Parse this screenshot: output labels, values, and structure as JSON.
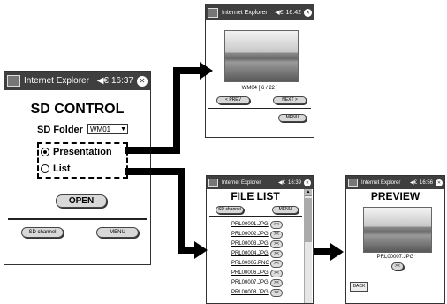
{
  "main_screen": {
    "titlebar": {
      "app": "Internet Explorer",
      "speaker": "◀€",
      "time": "16:37",
      "close": "✕"
    },
    "heading": "SD CONTROL",
    "folder_label": "SD Folder",
    "folder_value": "WM01",
    "options": [
      {
        "label": "Presentation",
        "selected": true
      },
      {
        "label": "List",
        "selected": false
      }
    ],
    "open_button": "OPEN",
    "sd_channel_button": "SD channel",
    "menu_button": "MENU"
  },
  "viewer_screen": {
    "titlebar": {
      "app": "Internet Explorer",
      "speaker": "◀€",
      "time": "16:42",
      "close": "✕"
    },
    "caption": "WM04 [ 6 / 22 ]",
    "prev_button": "< PREV",
    "next_button": "NEXT >",
    "menu_button": "MENU"
  },
  "file_list_screen": {
    "titlebar": {
      "app": "Internet Explorer",
      "speaker": "◀€",
      "time": "16:39",
      "close": "✕"
    },
    "heading": "FILE LIST",
    "sd_channel_button": "SD channel",
    "menu_button": "MENU",
    "files": [
      "PRL00001.JPG",
      "PRL00002.JPG",
      "PRL00003.JPG",
      "PRL00004.JPG",
      "PRL00005.PNG",
      "PRL00006.JPG",
      "PRL00007.JPG",
      "PRL00008.JPG"
    ]
  },
  "preview_screen": {
    "titlebar": {
      "app": "Internet Explorer",
      "speaker": "◀€",
      "time": "16:56",
      "close": "✕"
    },
    "heading": "PREVIEW",
    "filename": "PRL00007.JPG",
    "back_button": "BACK"
  },
  "colors": {
    "titlebar": "#3f3f3f",
    "button": "#d8d8d8",
    "arrow": "#000000"
  }
}
